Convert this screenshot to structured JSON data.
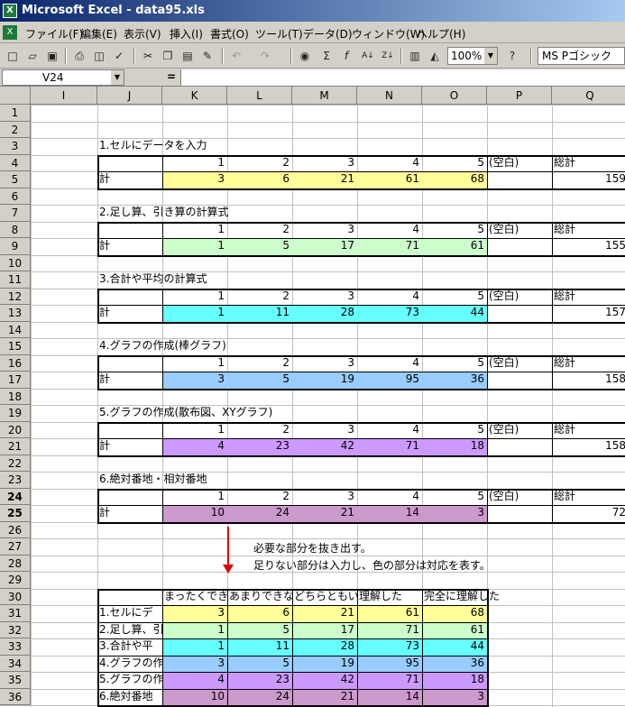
{
  "window": {
    "title": "Microsoft Excel - data95.xls"
  },
  "menu": [
    "ファイル(F)",
    "編集(E)",
    "表示(V)",
    "挿入(I)",
    "書式(O)",
    "ツール(T)",
    "データ(D)",
    "ウィンドウ(W)",
    "ヘルプ(H)"
  ],
  "toolbar": {
    "zoom": "100%",
    "font": "MS Pゴシック"
  },
  "formula_bar": {
    "name_box": "V24",
    "eq": "="
  },
  "columns": [
    "I",
    "J",
    "K",
    "L",
    "M",
    "N",
    "O",
    "P",
    "Q"
  ],
  "rows": [
    "1",
    "2",
    "3",
    "4",
    "5",
    "6",
    "7",
    "8",
    "9",
    "10",
    "11",
    "12",
    "13",
    "14",
    "15",
    "16",
    "17",
    "18",
    "19",
    "20",
    "21",
    "22",
    "23",
    "24",
    "25",
    "26",
    "27",
    "28",
    "29",
    "30",
    "31",
    "32",
    "33",
    "34",
    "35",
    "36"
  ],
  "colors": {
    "yellow": "#ffff99",
    "green": "#ccffcc",
    "cyan": "#66ffff",
    "blue": "#99ccff",
    "purple": "#cc99ff",
    "mauve": "#cc99cc"
  },
  "sections": [
    {
      "title": "1.セルにデータを入力",
      "headers": [
        "1",
        "2",
        "3",
        "4",
        "5",
        "(空白)",
        "総計"
      ],
      "label": "計",
      "values": [
        "3",
        "6",
        "21",
        "61",
        "68"
      ],
      "total": "159",
      "color": "yellow"
    },
    {
      "title": "2.足し算、引き算の計算式",
      "headers": [
        "1",
        "2",
        "3",
        "4",
        "5",
        "(空白)",
        "総計"
      ],
      "label": "計",
      "values": [
        "1",
        "5",
        "17",
        "71",
        "61"
      ],
      "total": "155",
      "color": "green"
    },
    {
      "title": "3.合計や平均の計算式",
      "headers": [
        "1",
        "2",
        "3",
        "4",
        "5",
        "(空白)",
        "総計"
      ],
      "label": "計",
      "values": [
        "1",
        "11",
        "28",
        "73",
        "44"
      ],
      "total": "157",
      "color": "cyan"
    },
    {
      "title": "4.グラフの作成(棒グラフ)",
      "headers": [
        "1",
        "2",
        "3",
        "4",
        "5",
        "(空白)",
        "総計"
      ],
      "label": "計",
      "values": [
        "3",
        "5",
        "19",
        "95",
        "36"
      ],
      "total": "158",
      "color": "blue"
    },
    {
      "title": "5.グラフの作成(散布図、XYグラフ)",
      "headers": [
        "1",
        "2",
        "3",
        "4",
        "5",
        "(空白)",
        "総計"
      ],
      "label": "計",
      "values": [
        "4",
        "23",
        "42",
        "71",
        "18"
      ],
      "total": "158",
      "color": "purple"
    },
    {
      "title": "6.絶対番地・相対番地",
      "headers": [
        "1",
        "2",
        "3",
        "4",
        "5",
        "(空白)",
        "総計"
      ],
      "label": "計",
      "values": [
        "10",
        "24",
        "21",
        "14",
        "3"
      ],
      "total": "72",
      "color": "mauve"
    }
  ],
  "notes": [
    "必要な部分を抜き出す。",
    "足りない部分は入力し、色の部分は対応を表す。"
  ],
  "summary": {
    "headers": [
      "まったくできない",
      "あまりできない",
      "どちらともいえない",
      "理解した",
      "完全に理解した"
    ],
    "header_visible": [
      "まったくでき",
      "あまりできな",
      "どちらともい",
      "理解した",
      "完全に理解した"
    ],
    "rows": [
      {
        "label": "1.セルにデ",
        "values": [
          "3",
          "6",
          "21",
          "61",
          "68"
        ],
        "color": "yellow"
      },
      {
        "label": "2.足し算、引",
        "values": [
          "1",
          "5",
          "17",
          "71",
          "61"
        ],
        "color": "green"
      },
      {
        "label": "3.合計や平",
        "values": [
          "1",
          "11",
          "28",
          "73",
          "44"
        ],
        "color": "cyan"
      },
      {
        "label": "4.グラフの作",
        "values": [
          "3",
          "5",
          "19",
          "95",
          "36"
        ],
        "color": "blue"
      },
      {
        "label": "5.グラフの作",
        "values": [
          "4",
          "23",
          "42",
          "71",
          "18"
        ],
        "color": "purple"
      },
      {
        "label": "6.絶対番地",
        "values": [
          "10",
          "24",
          "21",
          "14",
          "3"
        ],
        "color": "mauve"
      }
    ]
  }
}
